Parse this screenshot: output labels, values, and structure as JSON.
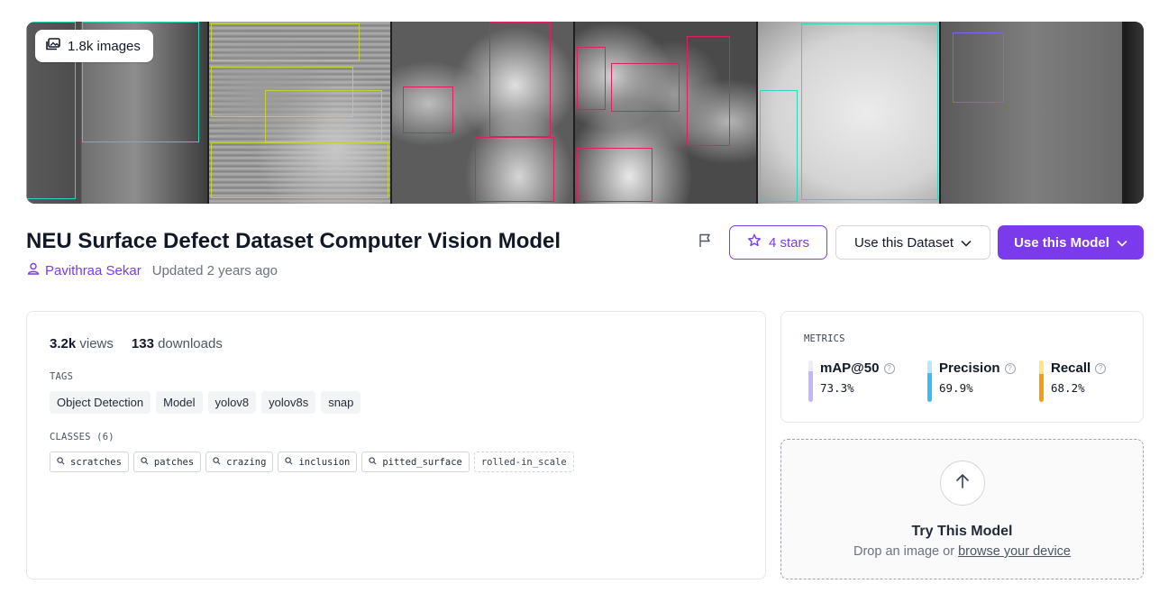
{
  "hero": {
    "image_count_label": "1.8k images"
  },
  "header": {
    "title": "NEU Surface Defect Dataset Computer Vision Model",
    "author": "Pavithraa Sekar",
    "updated": "Updated 2 years ago"
  },
  "actions": {
    "stars_label": "4 stars",
    "use_dataset_label": "Use this Dataset",
    "use_model_label": "Use this Model"
  },
  "stats": {
    "views_value": "3.2k",
    "views_label": "views",
    "downloads_value": "133",
    "downloads_label": "downloads"
  },
  "tags": {
    "label": "TAGS",
    "items": [
      "Object Detection",
      "Model",
      "yolov8",
      "yolov8s",
      "snap"
    ]
  },
  "classes": {
    "label": "CLASSES (6)",
    "items": [
      "scratches",
      "patches",
      "crazing",
      "inclusion",
      "pitted_surface",
      "rolled-in_scale"
    ]
  },
  "metrics": {
    "label": "METRICS",
    "items": [
      {
        "name": "mAP@50",
        "value": "73.3%",
        "fraction": 0.733,
        "color": "#c4b5fd",
        "track": "#ede9fe"
      },
      {
        "name": "Precision",
        "value": "69.9%",
        "fraction": 0.699,
        "color": "#38bdf8",
        "track": "#bae6fd"
      },
      {
        "name": "Recall",
        "value": "68.2%",
        "fraction": 0.682,
        "color": "#f59e0b",
        "track": "#fde68a"
      }
    ]
  },
  "try_model": {
    "title": "Try This Model",
    "prefix": "Drop an image or",
    "link": "browse your device"
  },
  "colors": {
    "accent": "#7c3aed"
  }
}
